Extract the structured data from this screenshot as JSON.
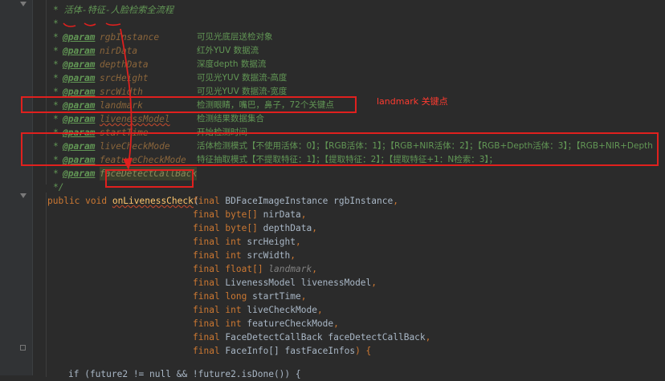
{
  "doc_title": "* 活体-特征-人脸检索全流程",
  "params": [
    {
      "tag": "@param",
      "name": "rgbInstance",
      "desc": "可见光底层送检对象"
    },
    {
      "tag": "@param",
      "name": "nirData",
      "desc": "红外YUV 数据流"
    },
    {
      "tag": "@param",
      "name": "depthData",
      "desc": "深度depth 数据流"
    },
    {
      "tag": "@param",
      "name": "srcHeight",
      "desc": "可见光YUV 数据流-高度"
    },
    {
      "tag": "@param",
      "name": "srcWidth",
      "desc": "可见光YUV 数据流-宽度"
    },
    {
      "tag": "@param",
      "name": "landmark",
      "desc": "检测眼睛，嘴巴，鼻子，72个关键点"
    },
    {
      "tag": "@param",
      "name": "livenessModel",
      "desc": "检测结果数据集合"
    },
    {
      "tag": "@param",
      "name": "startTime",
      "desc": "开始检测时间"
    },
    {
      "tag": "@param",
      "name": "liveCheckMode",
      "desc": "活体检测模式【不使用活体：0】；【RGB活体：1】；【RGB+NIR活体：2】；【RGB+Depth活体：3】；【RGB+NIR+Depth"
    },
    {
      "tag": "@param",
      "name": "featureCheckMode",
      "desc": "特征抽取模式【不提取特征：1】；【提取特征：2】；【提取特征+1：N检索：3】；"
    },
    {
      "tag": "@param",
      "name": "faceDetectCallBack",
      "desc": ""
    }
  ],
  "comment": {
    "star": "*",
    "end": "*/"
  },
  "signature": {
    "modifiers": "public void ",
    "method": "onLivenessCheck",
    "open": "(",
    "args": [
      {
        "kw": "final ",
        "type": "BDFaceImageInstance",
        "name": " rgbInstance",
        "tail": ","
      },
      {
        "kw": "final ",
        "type": "byte[]",
        "name": " nirData",
        "tail": ","
      },
      {
        "kw": "final ",
        "type": "byte[]",
        "name": " depthData",
        "tail": ","
      },
      {
        "kw": "final ",
        "type": "int",
        "name": " srcHeight",
        "tail": ","
      },
      {
        "kw": "final ",
        "type": "int",
        "name": " srcWidth",
        "tail": ","
      },
      {
        "kw": "final ",
        "type": "float[]",
        "name": " landmark",
        "tail": ","
      },
      {
        "kw": "final ",
        "type": "LivenessModel",
        "name": " livenessModel",
        "tail": ","
      },
      {
        "kw": "final ",
        "type": "long",
        "name": " startTime",
        "tail": ","
      },
      {
        "kw": "final ",
        "type": "int",
        "name": " liveCheckMode",
        "tail": ","
      },
      {
        "kw": "final ",
        "type": "int",
        "name": " featureCheckMode",
        "tail": ","
      },
      {
        "kw": "final ",
        "type": "FaceDetectCallBack",
        "name": " faceDetectCallBack",
        "tail": ","
      },
      {
        "kw": "final ",
        "type": "FaceInfo[]",
        "name": " fastFaceInfos",
        "tail": ") {"
      }
    ]
  },
  "bottom_line": "if (future2 != null && !future2.isDone()) {",
  "annotation": "landmark 关键点",
  "colors": {
    "comment": "#629755",
    "keyword": "#cc7832",
    "method": "#ffc66d",
    "param_name": "#8a653b",
    "annotation_red": "#e0201e",
    "background": "#2b2b2b"
  }
}
